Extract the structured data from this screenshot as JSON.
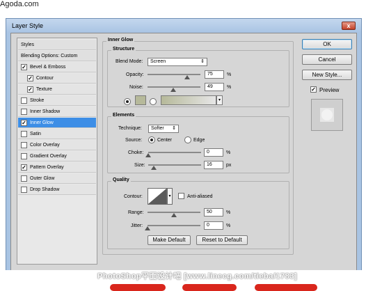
{
  "site": {
    "label": "Agoda.com"
  },
  "window": {
    "title": "Layer Style",
    "close_glyph": "x"
  },
  "styles_list": [
    {
      "label": "Styles",
      "type": "header",
      "checked": null,
      "selected": false
    },
    {
      "label": "Blending Options: Custom",
      "type": "header",
      "checked": null,
      "selected": false
    },
    {
      "label": "Bevel & Emboss",
      "type": "item",
      "checked": true,
      "selected": false
    },
    {
      "label": "Contour",
      "type": "sub",
      "checked": true,
      "selected": false
    },
    {
      "label": "Texture",
      "type": "sub",
      "checked": true,
      "selected": false
    },
    {
      "label": "Stroke",
      "type": "item",
      "checked": false,
      "selected": false
    },
    {
      "label": "Inner Shadow",
      "type": "item",
      "checked": false,
      "selected": false
    },
    {
      "label": "Inner Glow",
      "type": "item",
      "checked": true,
      "selected": true
    },
    {
      "label": "Satin",
      "type": "item",
      "checked": false,
      "selected": false
    },
    {
      "label": "Color Overlay",
      "type": "item",
      "checked": false,
      "selected": false
    },
    {
      "label": "Gradient Overlay",
      "type": "item",
      "checked": false,
      "selected": false
    },
    {
      "label": "Pattern Overlay",
      "type": "item",
      "checked": true,
      "selected": false
    },
    {
      "label": "Outer Glow",
      "type": "item",
      "checked": false,
      "selected": false
    },
    {
      "label": "Drop Shadow",
      "type": "item",
      "checked": false,
      "selected": false
    }
  ],
  "inner_glow": {
    "title": "Inner Glow",
    "structure": {
      "title": "Structure",
      "blend_mode_label": "Blend Mode:",
      "blend_mode_value": "Screen",
      "opacity_label": "Opacity:",
      "opacity_value": "75",
      "opacity_fraction": 0.75,
      "noise_label": "Noise:",
      "noise_value": "49",
      "noise_fraction": 0.49,
      "percent": "%",
      "color_swatch": "#b6b99a"
    },
    "elements": {
      "title": "Elements",
      "technique_label": "Technique:",
      "technique_value": "Softer",
      "source_label": "Source:",
      "source_center": "Center",
      "source_edge": "Edge",
      "choke_label": "Choke:",
      "choke_value": "0",
      "choke_fraction": 0,
      "size_label": "Size:",
      "size_value": "16",
      "size_unit": "px",
      "percent": "%"
    },
    "quality": {
      "title": "Quality",
      "contour_label": "Contour:",
      "anti_aliased_label": "Anti-aliased",
      "anti_aliased_checked": false,
      "range_label": "Range:",
      "range_value": "50",
      "range_fraction": 0.5,
      "jitter_label": "Jitter:",
      "jitter_value": "0",
      "jitter_fraction": 0,
      "percent": "%"
    },
    "make_default_label": "Make Default",
    "reset_default_label": "Reset to Default"
  },
  "buttons": {
    "ok": "OK",
    "cancel": "Cancel",
    "new_style": "New Style...",
    "preview_label": "Preview",
    "preview_checked": true
  },
  "footer": {
    "watermark": "PhotoShop平面设计吧 [www.linecg.com/tieba/1783]"
  },
  "colors": {
    "selected_row": "#3d8ee6",
    "window_frame": "#a9c4e3",
    "dialog_bg": "#d6d6d6"
  }
}
